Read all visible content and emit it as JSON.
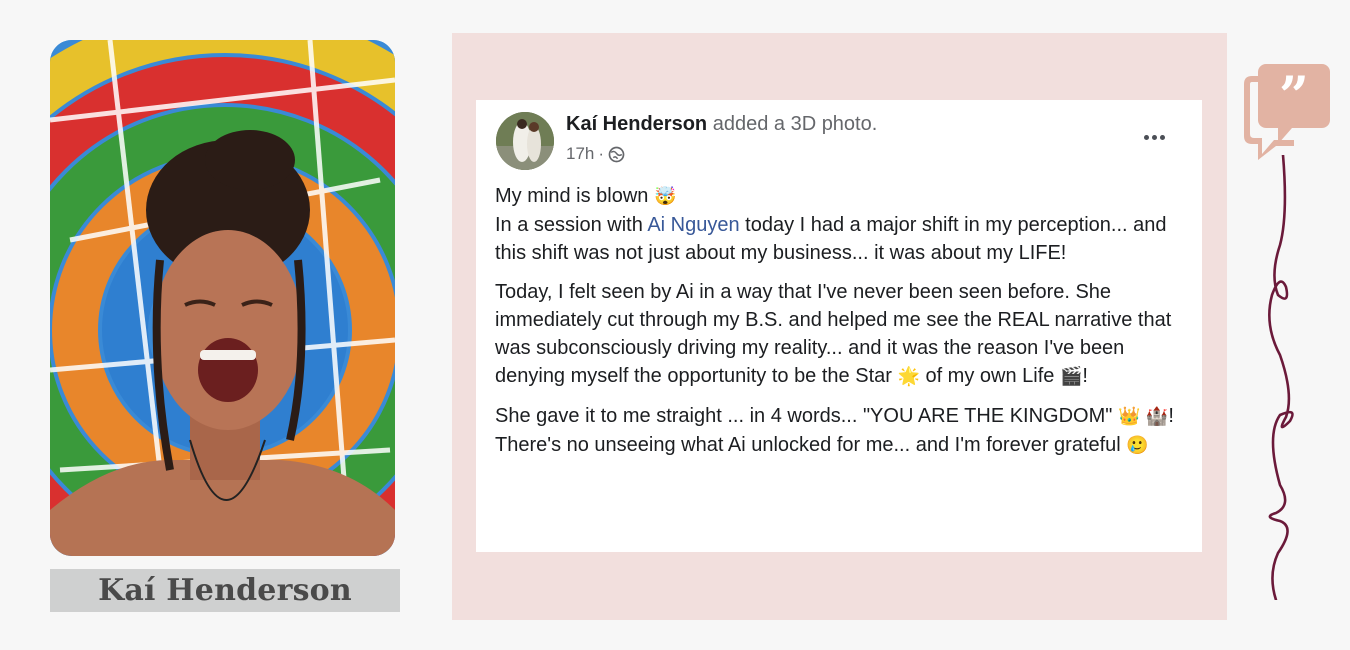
{
  "profile": {
    "name": "Kaí Henderson"
  },
  "post": {
    "author": "Kaí Henderson",
    "action": " added a 3D photo.",
    "time": "17h",
    "separator": " ·",
    "paragraph1": {
      "line1": "My mind is blown",
      "emoji1": "🤯",
      "before_mention": "In a session with ",
      "mention": "Ai Nguyen",
      "after_mention": " today I had a major shift in my perception... and this shift was not just about my business... it was about my LIFE!"
    },
    "paragraph2": {
      "text_a": "Today, I felt seen by Ai in a way that I've never been seen before.  She immediately cut through my B.S. and helped me see the REAL narrative that was subconsciously driving my reality... and it was the reason I've been denying myself the opportunity to be the Star ",
      "emoji_star": "🌟",
      "text_b": " of my own Life ",
      "emoji_clapper": "🎬",
      "text_c": "!"
    },
    "paragraph3": {
      "text_a": "She gave it to me straight ... in 4 words... \"YOU ARE THE KINGDOM\" ",
      "emoji_crown": "👑",
      "emoji_castle": "🏰",
      "text_b": "!  There's no unseeing what Ai unlocked for me... and I'm forever grateful ",
      "emoji_tear": "🥲"
    }
  },
  "colors": {
    "panel": "#f2dfdd",
    "quote_accent": "#e2b3a3",
    "swirl": "#6b1a3a",
    "mention": "#385898"
  },
  "icons": [
    "globe-icon",
    "more-options-icon",
    "quote-icon",
    "decorative-swirl"
  ]
}
